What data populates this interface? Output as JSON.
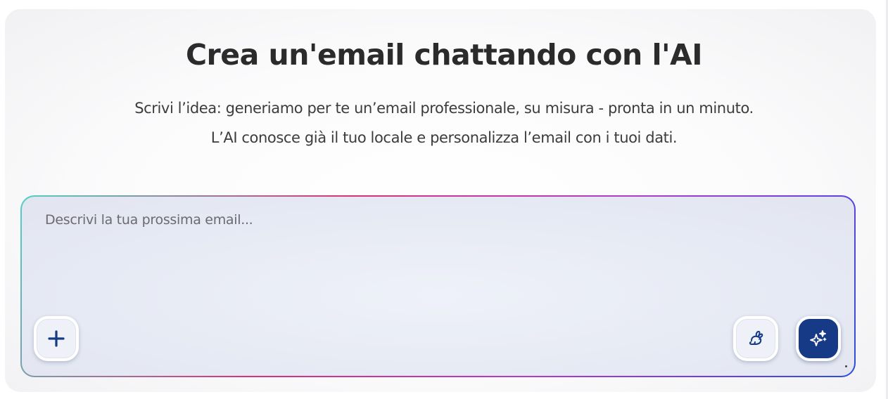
{
  "header": {
    "title": "Crea un'email chattando con l'AI",
    "subtitle_line1": "Scrivi l’idea: generiamo per te un’email professionale, su misura - pronta in un minuto.",
    "subtitle_line2": "L’AI conosce già il tuo locale e personalizza l’email con i tuoi dati."
  },
  "composer": {
    "placeholder": "Descrivi la tua prossima email...",
    "value": "",
    "buttons": {
      "add": {
        "icon": "plus-icon"
      },
      "fast_mode": {
        "icon": "rabbit-icon"
      },
      "generate": {
        "icon": "sparkles-icon"
      }
    }
  },
  "colors": {
    "accent": "#163a86",
    "gradient_start": "#4fd1c5",
    "gradient_mid": "#d6337a",
    "gradient_end": "#2b4fd8",
    "title_text": "#2b2b2b"
  }
}
